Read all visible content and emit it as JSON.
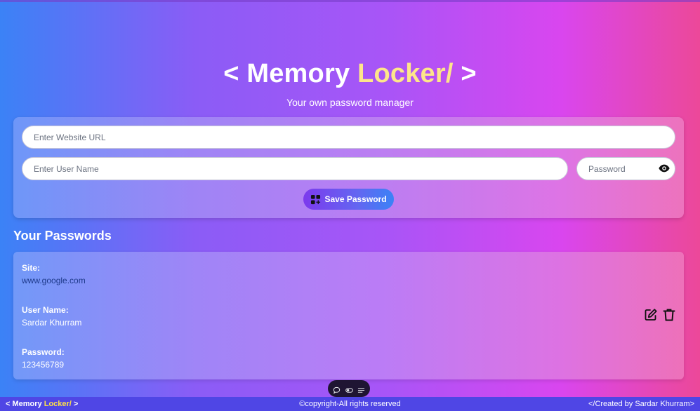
{
  "header": {
    "title_open": "< Memory ",
    "title_locker": "Locker/",
    "title_close": " >",
    "subtitle": "Your own password manager"
  },
  "form": {
    "url_placeholder": "Enter Website URL",
    "username_placeholder": "Enter User Name",
    "password_placeholder": "Password",
    "save_label": "Save Password"
  },
  "passwords": {
    "title": "Your Passwords",
    "entries": [
      {
        "site_label": "Site:",
        "site": "www.google.com",
        "username_label": "User Name:",
        "username": "Sardar Khurram",
        "password_label": "Password:",
        "password": "123456789"
      }
    ]
  },
  "footer": {
    "brand_open": "< Memory ",
    "brand_locker": "Locker/",
    "brand_close": " >",
    "copyright": "©copyright-All rights reserved",
    "credit": "</Created by Sardar Khurram>"
  },
  "icons": {
    "save": "add-grid-icon",
    "eye": "eye-icon",
    "edit": "edit-icon",
    "delete": "trash-icon"
  },
  "colors": {
    "accent_yellow": "#fde68a",
    "button_start": "#7c3aed",
    "button_end": "#3b82f6",
    "footer_bg": "#4f46e5"
  }
}
